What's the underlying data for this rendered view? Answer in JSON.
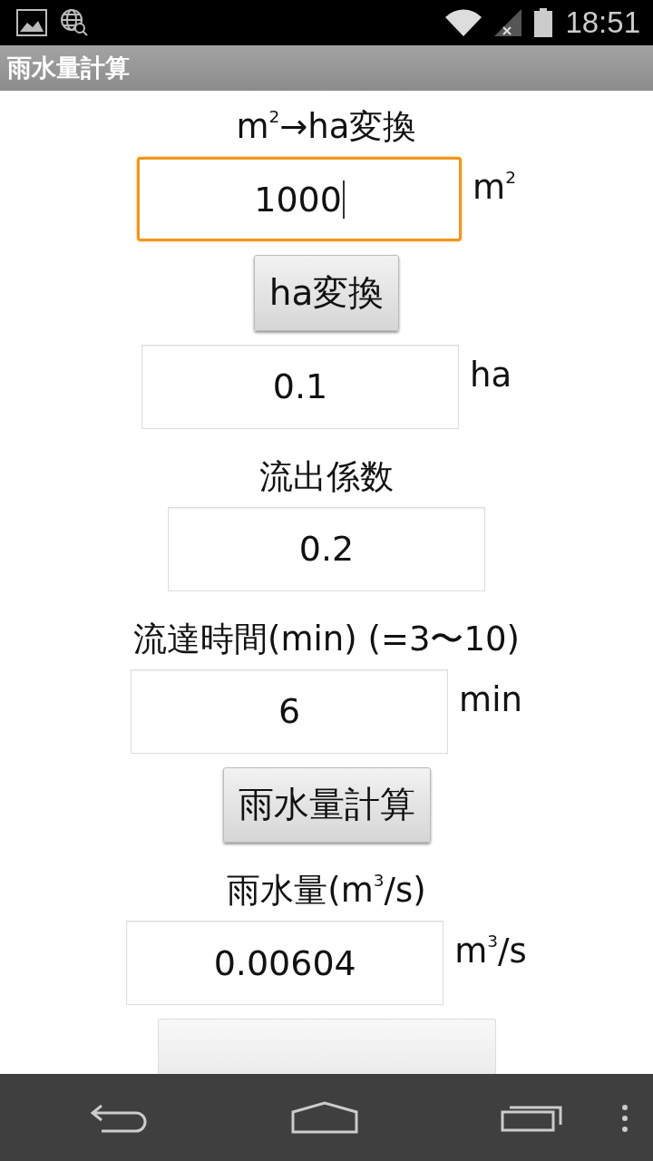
{
  "status_bar": {
    "time": "18:51"
  },
  "action_bar": {
    "title": "雨水量計算"
  },
  "form": [
    {
      "kind": "label",
      "text": "m$^{2}$→ha変換"
    },
    {
      "kind": "field",
      "value": "1000",
      "unit": "m$^{2}$",
      "focused": true
    },
    {
      "kind": "button",
      "text": "ha変換"
    },
    {
      "kind": "field",
      "value": "0.1",
      "unit": "ha",
      "focused": false
    },
    {
      "kind": "label",
      "text": "流出係数"
    },
    {
      "kind": "field",
      "value": "0.2",
      "focused": false
    },
    {
      "kind": "label",
      "text": "流達時間(min) (=3〜10)"
    },
    {
      "kind": "field",
      "value": "6",
      "unit": "min",
      "focused": false
    },
    {
      "kind": "button",
      "text": "雨水量計算"
    },
    {
      "kind": "label",
      "text": "雨水量(m$^{3}$/s)"
    },
    {
      "kind": "field",
      "value": "0.00604",
      "unit": "m$^{3}$/s",
      "focused": false
    },
    {
      "kind": "hidden_button"
    }
  ]
}
